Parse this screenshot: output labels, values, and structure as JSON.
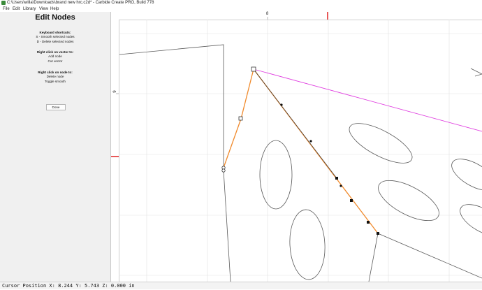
{
  "window": {
    "title": "C:\\Users\\willa\\Downloads\\brand new hrc.c2d* - Carbide Create PRO, Build 778"
  },
  "menu": [
    "File",
    "Edit",
    "Library",
    "View",
    "Help"
  ],
  "panel": {
    "title": "Edit Nodes",
    "shortcuts_heading": "Keyboard shortcuts:",
    "shortcut_smooth": "S - Smooth selected nodes",
    "shortcut_delete": "D - Delete selected nodes",
    "vector_heading": "Right click on vector to:",
    "vector_add": "Add node",
    "vector_cut": "Cut vector",
    "node_heading": "Right click on node to:",
    "node_delete": "Delete node",
    "node_toggle": "Toggle smooth",
    "done_label": "Done"
  },
  "rulers": {
    "top_label": "8",
    "left_label": "6"
  },
  "status": {
    "text": "Cursor Position X: 8.244 Y: 5.743 Z: 0.000 in"
  },
  "colors": {
    "selected_path": "#f08a2c",
    "guide_line": "#e040e0",
    "ruler_marker": "#e02020",
    "panel_bg": "#f0f0f0"
  }
}
